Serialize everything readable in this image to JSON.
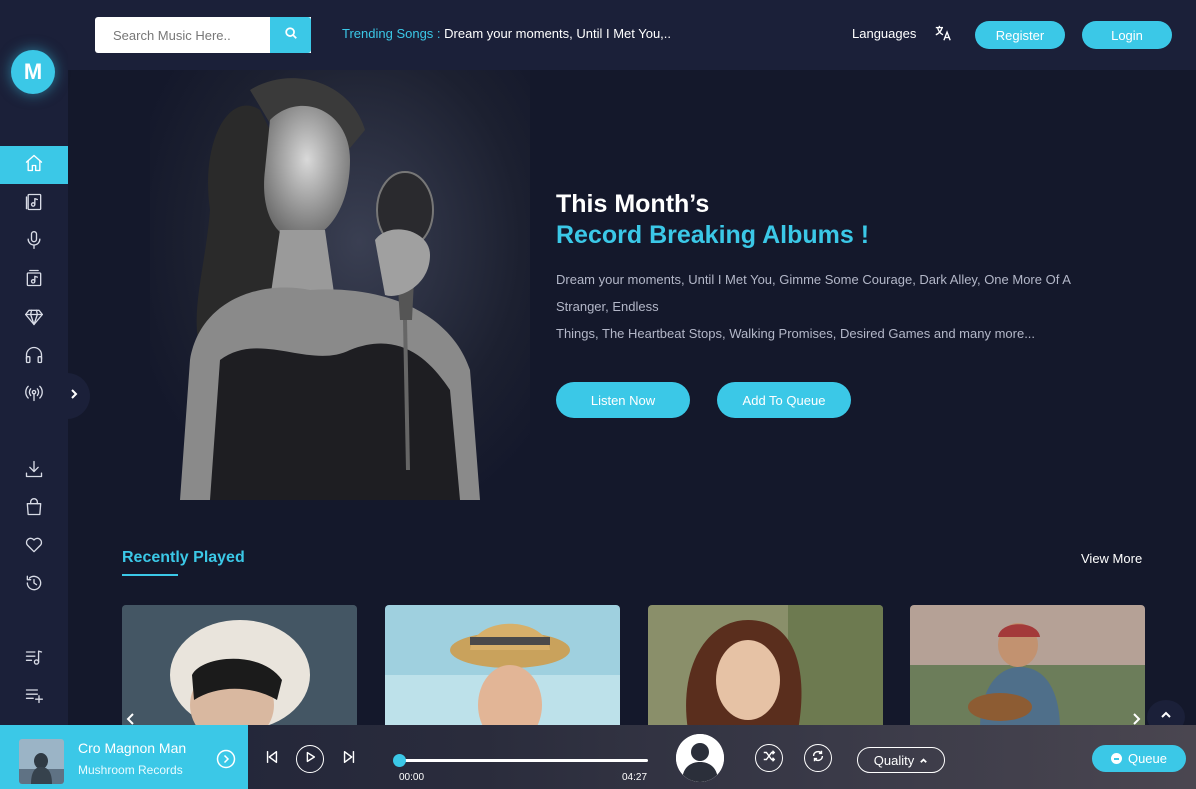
{
  "brand": {
    "logo_letter": "M",
    "accent": "#3bc8e7"
  },
  "sidebar": {
    "items": [
      {
        "name": "home",
        "icon": "home-icon",
        "active": true
      },
      {
        "name": "albums",
        "icon": "album-icon",
        "active": false
      },
      {
        "name": "artists",
        "icon": "microphone-icon",
        "active": false
      },
      {
        "name": "genres",
        "icon": "music-box-icon",
        "active": false
      },
      {
        "name": "top-tracks",
        "icon": "diamond-icon",
        "active": false
      },
      {
        "name": "free-music",
        "icon": "headphones-icon",
        "active": false
      },
      {
        "name": "stations",
        "icon": "broadcast-icon",
        "active": false
      },
      {
        "name": "downloads",
        "icon": "download-icon",
        "active": false
      },
      {
        "name": "purchased",
        "icon": "shopping-bag-icon",
        "active": false
      },
      {
        "name": "favourites",
        "icon": "heart-icon",
        "active": false
      },
      {
        "name": "history",
        "icon": "history-icon",
        "active": false
      },
      {
        "name": "featured-playlist",
        "icon": "playlist-icon",
        "active": false
      },
      {
        "name": "create-playlist",
        "icon": "add-playlist-icon",
        "active": false
      }
    ]
  },
  "topbar": {
    "search_placeholder": "Search Music Here..",
    "trending_label": "Trending Songs :",
    "trending_value": "Dream your moments, Until I Met You,..",
    "languages_label": "Languages",
    "register_label": "Register",
    "login_label": "Login"
  },
  "hero": {
    "title_line1": "This Month’s",
    "title_line2": "Record Breaking Albums !",
    "description_line1": "Dream your moments, Until I Met You, Gimme Some Courage, Dark Alley, One More Of A",
    "description_line2": "Stranger, Endless",
    "description_line3": "Things, The Heartbeat Stops, Walking Promises, Desired Games and many more...",
    "listen_now_label": "Listen Now",
    "add_to_queue_label": "Add To Queue"
  },
  "recently_played": {
    "title": "Recently Played",
    "view_more_label": "View More"
  },
  "player": {
    "track_title": "Cro Magnon Man",
    "track_label": "Mushroom Records",
    "current_time": "00:00",
    "total_time": "04:27",
    "progress": 0.0,
    "quality_label": "Quality",
    "queue_label": "Queue"
  }
}
